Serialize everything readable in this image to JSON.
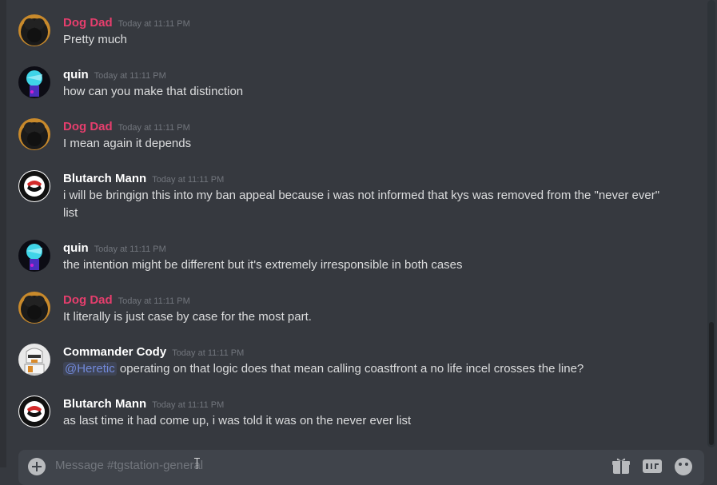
{
  "messages": [
    {
      "author": "Dog Dad",
      "color": "#e63e6d",
      "avatar_icon": "black-dog-avatar-icon",
      "time": "Today at 11:11 PM",
      "text": "Pretty much"
    },
    {
      "author": "quin",
      "color": "#ffffff",
      "avatar_icon": "blue-figure-avatar-icon",
      "time": "Today at 11:11 PM",
      "text": "how can you make that distinction"
    },
    {
      "author": "Dog Dad",
      "color": "#e63e6d",
      "avatar_icon": "black-dog-avatar-icon",
      "time": "Today at 11:11 PM",
      "text": "I mean again it depends"
    },
    {
      "author": "Blutarch Mann",
      "color": "#ffffff",
      "avatar_icon": "antifa-flag-avatar-icon",
      "time": "Today at 11:11 PM",
      "text": "i will be bringign this into my ban appeal because i was not informed that kys was removed from the \"never ever\" list"
    },
    {
      "author": "quin",
      "color": "#ffffff",
      "avatar_icon": "blue-figure-avatar-icon",
      "time": "Today at 11:11 PM",
      "text": "the intention might be different but it's extremely irresponsible in both cases"
    },
    {
      "author": "Dog Dad",
      "color": "#e63e6d",
      "avatar_icon": "black-dog-avatar-icon",
      "time": "Today at 11:11 PM",
      "text": "It literally is just case by case for the most part."
    },
    {
      "author": "Commander Cody",
      "color": "#ffffff",
      "avatar_icon": "clone-trooper-avatar-icon",
      "time": "Today at 11:11 PM",
      "mention": "@Heretic",
      "text": " operating on that logic does that mean calling coastfront a no life incel crosses the line?"
    },
    {
      "author": "Blutarch Mann",
      "color": "#ffffff",
      "avatar_icon": "antifa-flag-avatar-icon",
      "time": "Today at 11:11 PM",
      "text": "as last time it had come up, i was told it was on the never ever list"
    }
  ],
  "composer": {
    "placeholder": "Message #tgstation-general",
    "icons": [
      "gift-icon",
      "gif-icon",
      "emoji-icon"
    ]
  },
  "colors": {
    "background": "#36393f",
    "composer": "#40444b",
    "mention": "#7289da",
    "timestamp": "#72767d"
  }
}
